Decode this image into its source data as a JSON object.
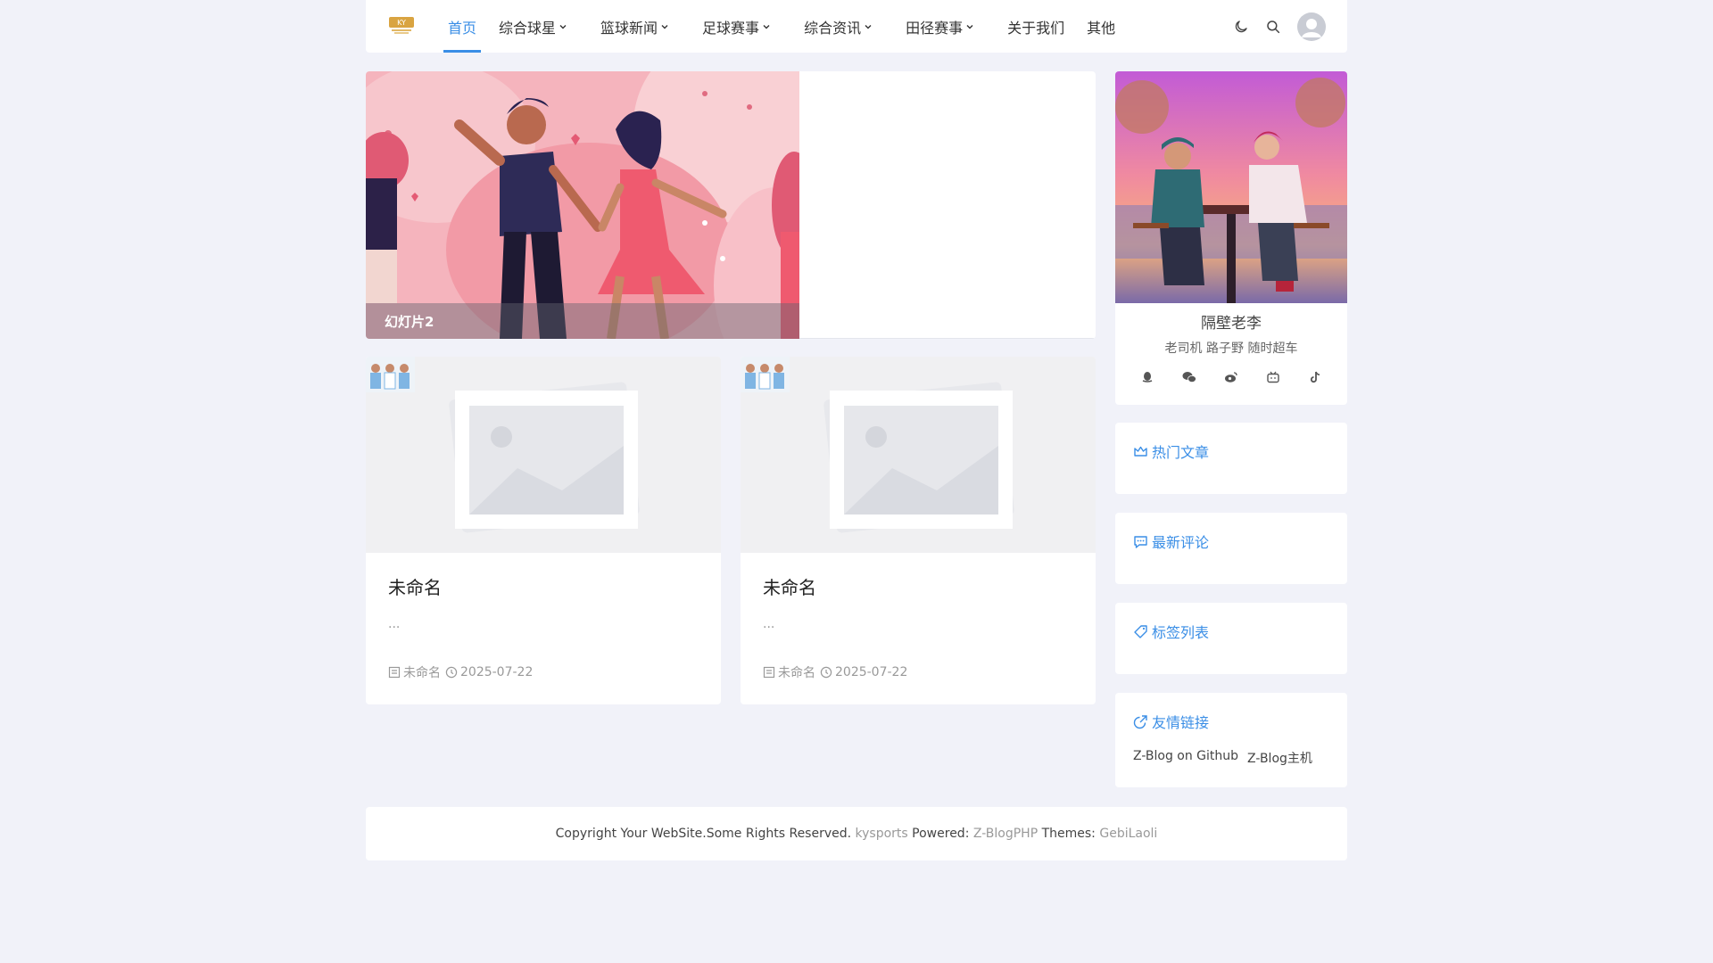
{
  "nav": {
    "items": [
      {
        "label": "首页",
        "active": true,
        "dropdown": false
      },
      {
        "label": "综合球星",
        "dropdown": true
      },
      {
        "label": "篮球新闻",
        "dropdown": true
      },
      {
        "label": "足球赛事",
        "dropdown": true
      },
      {
        "label": "综合资讯",
        "dropdown": true
      },
      {
        "label": "田径赛事",
        "dropdown": true
      },
      {
        "label": "关于我们",
        "dropdown": false
      },
      {
        "label": "其他",
        "dropdown": false
      }
    ]
  },
  "slider": {
    "caption": "幻灯片2"
  },
  "posts": [
    {
      "title": "未命名",
      "excerpt": "...",
      "category": "未命名",
      "date": "2025-07-22"
    },
    {
      "title": "未命名",
      "excerpt": "...",
      "category": "未命名",
      "date": "2025-07-22"
    }
  ],
  "profile": {
    "name": "隔壁老李",
    "desc": "老司机 路子野 随时超车",
    "social_icons": [
      "qq-icon",
      "wechat-icon",
      "weibo-icon",
      "bilibili-icon",
      "tiktok-icon"
    ]
  },
  "widgets": {
    "hot": "热门文章",
    "comments": "最新评论",
    "tags": "标签列表",
    "links": "友情链接",
    "link_items": [
      "Z-Blog on Github",
      "Z-Blog主机"
    ]
  },
  "footer": {
    "copyright": "Copyright Your WebSite.Some Rights Reserved.",
    "site": "kysports",
    "powered_label": "Powered:",
    "powered": "Z-BlogPHP",
    "themes_label": "Themes:",
    "theme": "GebiLaoli"
  },
  "colors": {
    "accent": "#3a8ee6",
    "background": "#f1f2f9"
  }
}
